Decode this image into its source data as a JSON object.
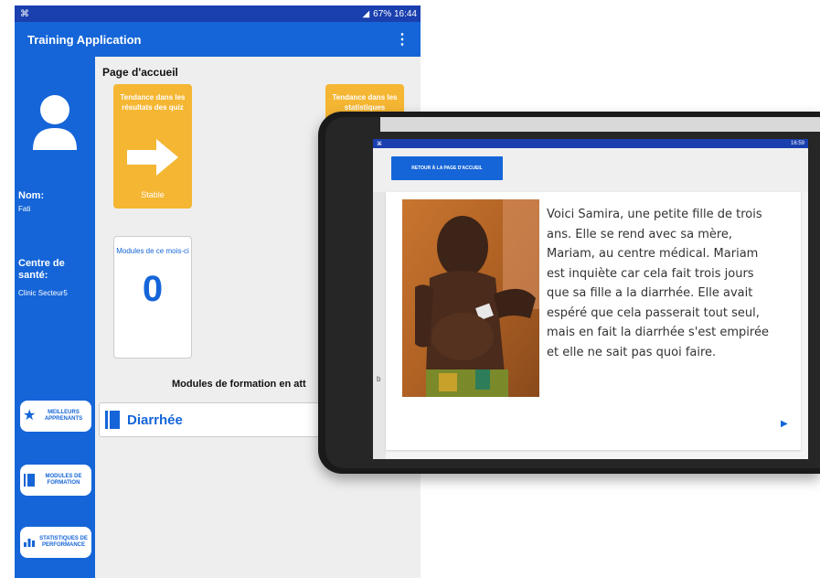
{
  "phone": {
    "status_time": "67% 16:44",
    "app_title": "Training Application",
    "menu_icon": "⋮",
    "sidebar": {
      "name_label": "Nom:",
      "name_value": "Fati",
      "center_label": "Centre de santé:",
      "center_value": "Clinic Secteur5",
      "buttons": [
        {
          "label": "MEILLEURS APPRENANTS",
          "icon": "star-icon"
        },
        {
          "label": "MODULES DE FORMATION",
          "icon": "book-icon"
        },
        {
          "label": "STATISTIQUES DE PERFORMANCE",
          "icon": "chart-icon"
        }
      ]
    },
    "main": {
      "page_title": "Page d'accueil",
      "tile_quiz_title": "Tendance dans les résultats des quiz",
      "tile_quiz_status": "Stable",
      "tile_stats_title": "Tendance dans les statistiques",
      "modules_month_title": "Modules de ce mois-ci",
      "modules_month_count": "0",
      "section_title": "Modules de formation en att",
      "module_name": "Diarrhée"
    }
  },
  "tablet": {
    "status_time": "16:59",
    "back_button": "RETOUR À LA PAGE D'ACCUEIL",
    "story_text": "Voici Samira, une petite fille de trois ans. Elle se rend avec sa mère, Mariam, au centre médical. Mariam est inquiète car cela fait trois jours que sa fille a la diarrhée. Elle avait espéré que cela passerait tout seul, mais en fait la diarrhée s'est empirée et elle ne sait pas quoi faire.",
    "next_icon": "▶"
  },
  "colors": {
    "primary_blue": "#1565d8",
    "status_blue": "#1a3fae",
    "tile_orange": "#f5b633"
  }
}
